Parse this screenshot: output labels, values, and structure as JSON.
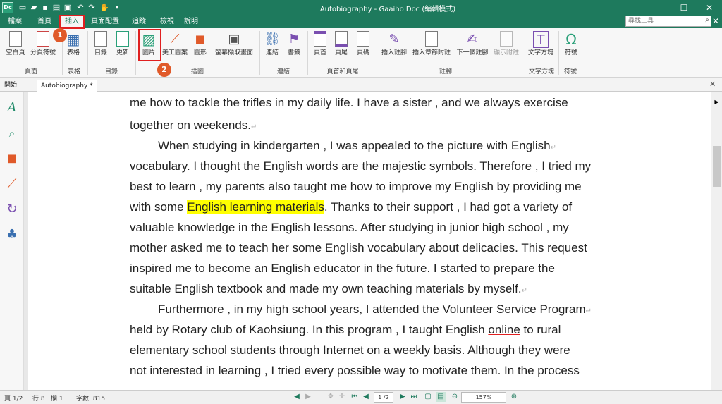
{
  "window": {
    "title": "Autobiography - Gaaiho Doc (編輯模式)",
    "app_icon": "Dc"
  },
  "quick_access": [
    "new-icon",
    "open-icon",
    "save-icon",
    "print-icon",
    "undo-icon",
    "redo-icon",
    "hand-tool-icon"
  ],
  "menu": {
    "items": [
      "檔案",
      "首頁",
      "插入",
      "頁面配置",
      "追蹤",
      "檢視",
      "說明"
    ],
    "active_index": 2
  },
  "search": {
    "placeholder": "尋找工具"
  },
  "ribbon": {
    "buttons": [
      "空白頁",
      "分頁符號",
      "表格",
      "目錄",
      "更新",
      "圖片",
      "美工圖案",
      "圖形",
      "螢幕擷取畫面",
      "連結",
      "書籤",
      "頁首",
      "頁尾",
      "頁碼",
      "插入註腳",
      "插入章節附註",
      "下一個註腳",
      "顯示附註",
      "文字方塊",
      "符號"
    ],
    "groups": [
      "頁面",
      "表格",
      "目錄",
      "插圖",
      "連結",
      "頁首和頁尾",
      "註腳",
      "文字方塊",
      "符號"
    ]
  },
  "annotations": {
    "badge1": "1",
    "badge2": "2"
  },
  "tabs": {
    "home": "開始",
    "doc": "Autobiography *"
  },
  "document": {
    "lines": [
      "me how to tackle the trifles in my daily life. I have a sister , and we always exercise",
      "together on weekends.",
      "When studying in kindergarten , I was appealed to the picture with English",
      "vocabulary. I thought the English words are the majestic symbols. Therefore , I tried my",
      "best to learn , my parents also taught me how to improve my English by providing me",
      "with some ",
      "English learning materials",
      ". Thanks to their support , I had got a variety of",
      "valuable knowledge in the English lessons. After studying in junior high school , my",
      "mother asked me to teach her some English vocabulary about delicacies. This request",
      "inspired me to become an English educator in the future. I started to prepare the",
      "suitable English textbook and made my own teaching materials by myself.",
      "Furthermore , in my high school years, I attended the Volunteer Service Program",
      "held by Rotary club of Kaohsiung. In this program , I taught English ",
      "online",
      " to rural",
      "elementary school students through Internet on a weekly basis. Although they were",
      "not interested in learning , I tried every possible way to motivate them. In the process"
    ],
    "para_mark": "↵"
  },
  "status": {
    "page": "頁 1/2",
    "line": "行 8",
    "column": "欄 1",
    "wordcount": "字數: 815",
    "page_input": "1 /2",
    "zoom": "157%"
  },
  "colors": {
    "accent": "#1e7a5d",
    "highlight": "#ffff00",
    "callout": "#e02020",
    "badge": "#e05a2a"
  }
}
